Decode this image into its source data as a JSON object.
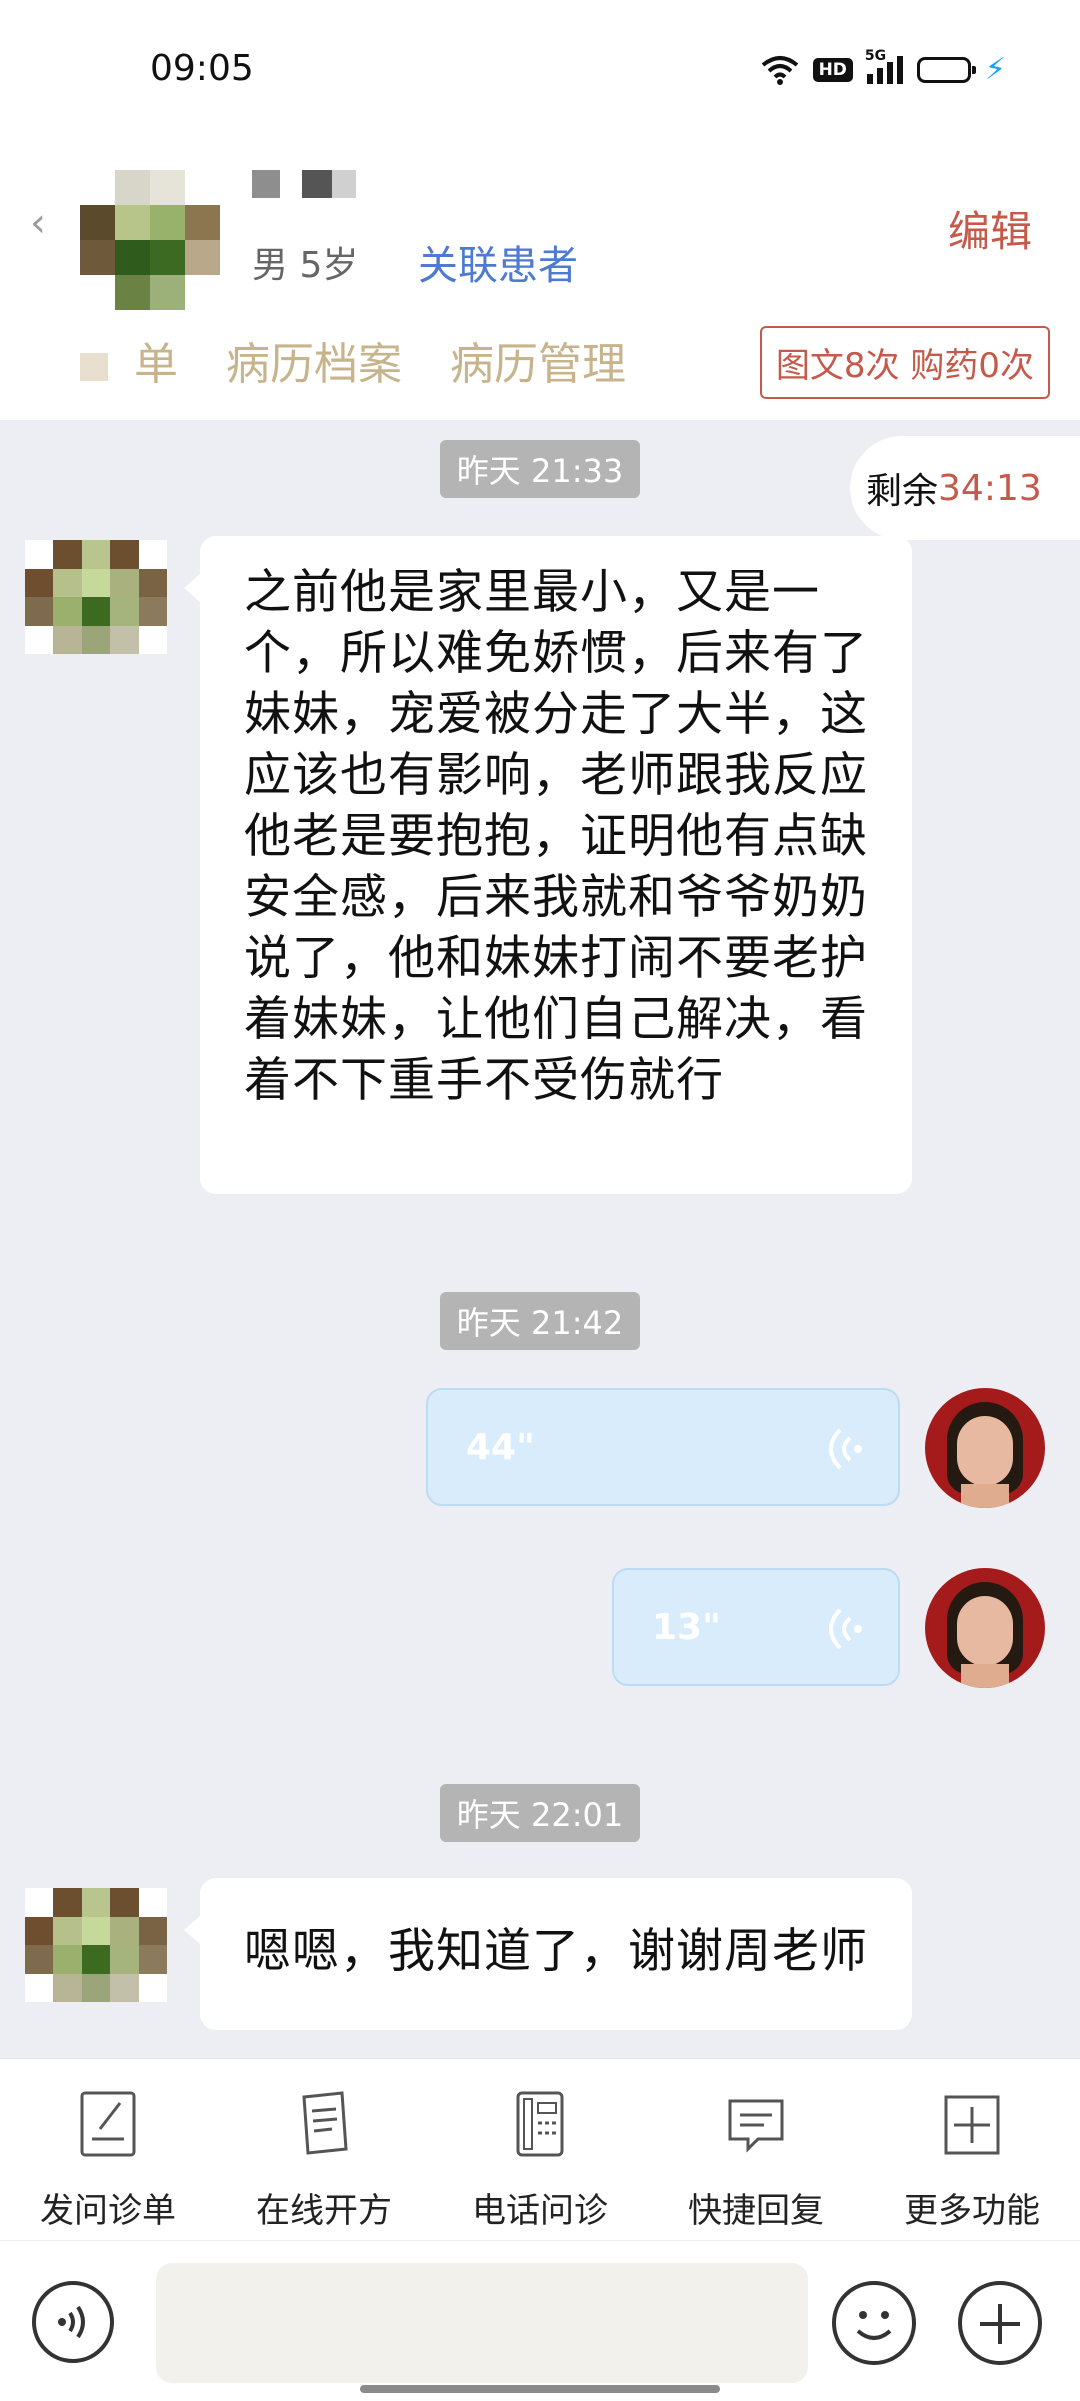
{
  "status_bar": {
    "time": "09:05",
    "network_label": "5G",
    "hd_label": "HD",
    "accent_color": "#1aa1f0"
  },
  "header": {
    "patient_gender_age": "男 5岁",
    "link_patient_label": "关联患者",
    "edit_label": "编辑",
    "tabs": [
      "单",
      "病历档案",
      "病历管理"
    ],
    "stats_badge": "图文8次 购药0次"
  },
  "remaining": {
    "label": "剩余",
    "value": "34:13"
  },
  "messages": [
    {
      "time": "昨天 21:33",
      "sender": "patient",
      "text": "之前他是家里最小，又是一个，所以难免娇惯，后来有了妹妹，宠爱被分走了大半，这应该也有影响，老师跟我反应他老是要抱抱，证明他有点缺安全感，后来我就和爷爷奶奶说了，他和妹妹打闹不要老护着妹妹，让他们自己解决，看着不下重手不受伤就行"
    },
    {
      "time": "昨天 21:42",
      "sender": "doctor",
      "voice_duration_1": "44\"",
      "voice_duration_2": "13\""
    },
    {
      "time": "昨天 22:01",
      "sender": "patient",
      "text": "嗯嗯，我知道了，谢谢周老师"
    }
  ],
  "toolbar": {
    "items": [
      "发问诊单",
      "在线开方",
      "电话问诊",
      "快捷回复",
      "更多功能"
    ]
  },
  "colors": {
    "accent_red": "#c5594a",
    "link_blue": "#4e7bd0",
    "tab_tan": "#c8b48c",
    "voice_bubble": "#d8ecfb"
  }
}
